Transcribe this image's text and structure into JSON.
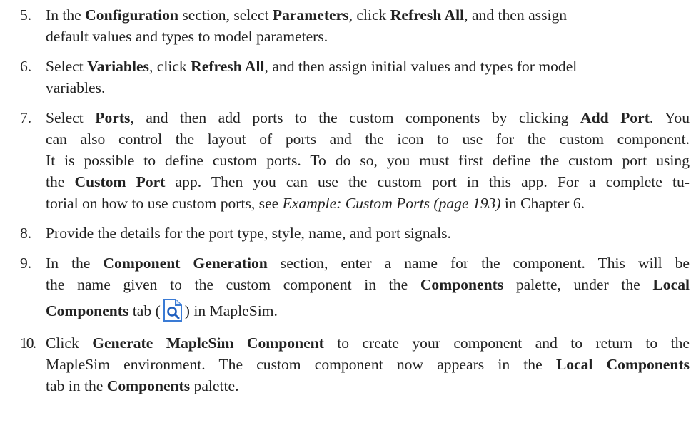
{
  "steps": [
    {
      "num": "5.",
      "lines": [
        [
          {
            "t": "In the ",
            "s": "n"
          },
          {
            "t": "Configuration",
            "s": "b"
          },
          {
            "t": " section, select ",
            "s": "n"
          },
          {
            "t": "Parameters",
            "s": "b"
          },
          {
            "t": ", click ",
            "s": "n"
          },
          {
            "t": "Refresh All",
            "s": "b"
          },
          {
            "t": ", and then assign",
            "s": "n"
          }
        ],
        [
          {
            "t": "default values and types to model parameters.",
            "s": "n"
          }
        ]
      ]
    },
    {
      "num": "6.",
      "lines": [
        [
          {
            "t": "Select ",
            "s": "n"
          },
          {
            "t": "Variables",
            "s": "b"
          },
          {
            "t": ", click ",
            "s": "n"
          },
          {
            "t": "Refresh All",
            "s": "b"
          },
          {
            "t": ", and then assign initial values and types for model",
            "s": "n"
          }
        ],
        [
          {
            "t": "variables.",
            "s": "n"
          }
        ]
      ]
    },
    {
      "num": "7.",
      "lines": [
        [
          {
            "t": "Select ",
            "s": "n"
          },
          {
            "t": "Ports",
            "s": "b"
          },
          {
            "t": ", and then add ports to the custom components by clicking ",
            "s": "n"
          },
          {
            "t": "Add Port",
            "s": "b"
          },
          {
            "t": ". You",
            "s": "n"
          }
        ],
        [
          {
            "t": "can also control the layout of ports and the icon to use for the custom component.",
            "s": "n"
          }
        ],
        [
          {
            "t": "It is possible to define custom ports. To do so, you must first define the custom port using",
            "s": "n"
          }
        ],
        [
          {
            "t": "the ",
            "s": "n"
          },
          {
            "t": "Custom Port",
            "s": "b"
          },
          {
            "t": " app. Then you can use the custom port in this app. For a complete tu-",
            "s": "n"
          }
        ],
        [
          {
            "t": "torial on how to use custom ports, see ",
            "s": "n"
          },
          {
            "t": "Example: Custom Ports (page 193)",
            "s": "i"
          },
          {
            "t": " in Chapter 6.",
            "s": "n"
          }
        ]
      ]
    },
    {
      "num": "8.",
      "lines": [
        [
          {
            "t": "Provide the details for the port type, style, name, and port signals.",
            "s": "n"
          }
        ]
      ]
    },
    {
      "num": "9.",
      "lines": [
        [
          {
            "t": "In the ",
            "s": "n"
          },
          {
            "t": "Component Generation",
            "s": "b"
          },
          {
            "t": " section, enter a name for the component. This will be",
            "s": "n"
          }
        ],
        [
          {
            "t": "the name given to the custom component in the ",
            "s": "n"
          },
          {
            "t": "Components",
            "s": "b"
          },
          {
            "t": " palette, under the ",
            "s": "n"
          },
          {
            "t": "Local",
            "s": "b"
          }
        ],
        [
          {
            "t": "Components",
            "s": "b"
          },
          {
            "t": " tab (",
            "s": "n"
          },
          {
            "icon": "local-components-tab-icon"
          },
          {
            "t": ") in MapleSim.",
            "s": "n"
          }
        ]
      ]
    },
    {
      "num": "10.",
      "lines": [
        [
          {
            "t": "Click ",
            "s": "n"
          },
          {
            "t": "Generate MapleSim Component",
            "s": "b"
          },
          {
            "t": " to create your component and to return to the",
            "s": "n"
          }
        ],
        [
          {
            "t": "MapleSim environment. The custom component now appears in the ",
            "s": "n"
          },
          {
            "t": "Local Components",
            "s": "b"
          }
        ],
        [
          {
            "t": "tab in the ",
            "s": "n"
          },
          {
            "t": "Components",
            "s": "b"
          },
          {
            "t": " palette.",
            "s": "n"
          }
        ]
      ]
    }
  ]
}
